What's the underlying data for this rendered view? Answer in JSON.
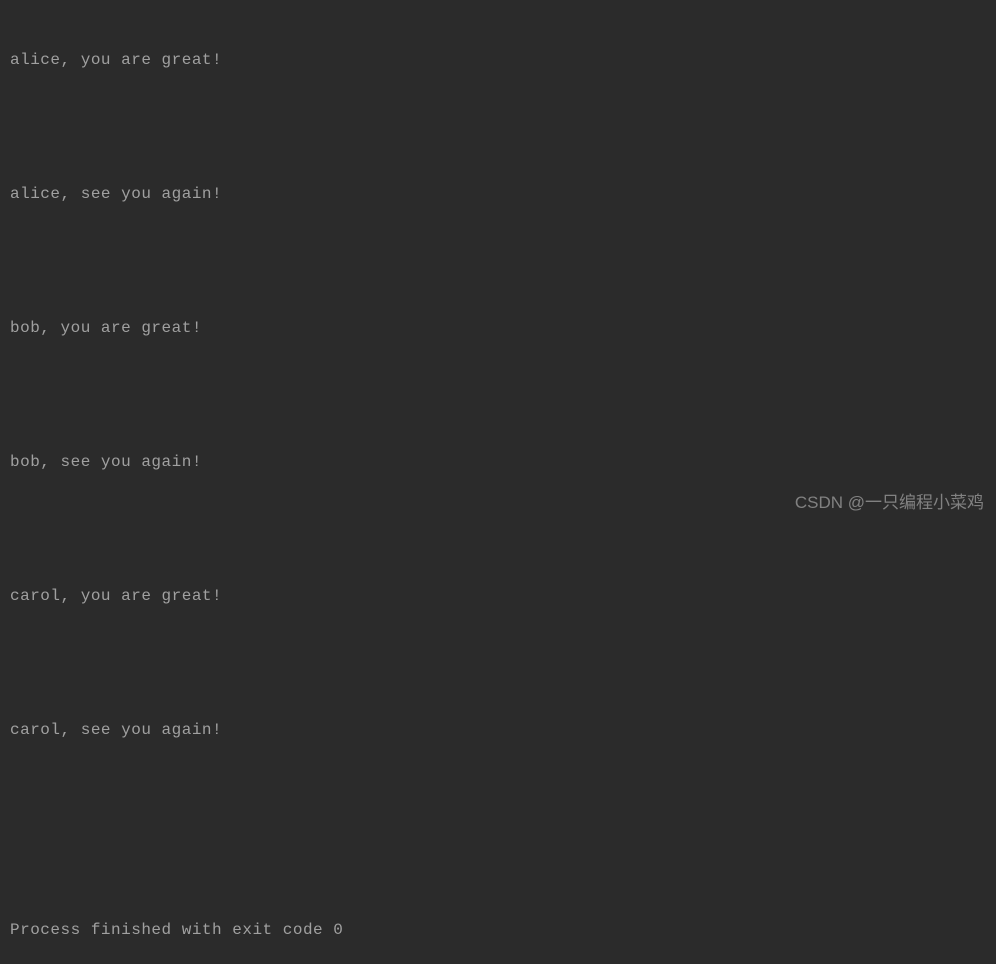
{
  "console": {
    "lines": [
      "alice, you are great!",
      "",
      "alice, see you again!",
      "",
      "bob, you are great!",
      "",
      "bob, see you again!",
      "",
      "carol, you are great!",
      "",
      "carol, see you again!",
      "",
      "",
      "Process finished with exit code 0"
    ]
  },
  "watermark": "CSDN @一只编程小菜鸡"
}
